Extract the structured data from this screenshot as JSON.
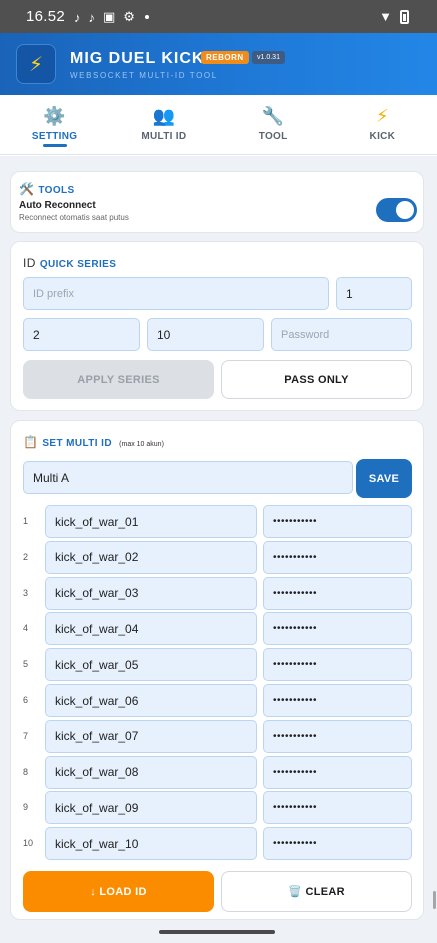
{
  "status": {
    "time": "16.52"
  },
  "app": {
    "logo_glyph": "⚡",
    "title": "MIG DUEL KICK",
    "badge": "REBORN",
    "version": "v1.0.31",
    "subtitle": "WEBSOCKET MULTI-ID TOOL",
    "accent": "#1f6fbf",
    "orange": "#fb8c00"
  },
  "tabs": [
    {
      "label": "SETTING",
      "icon": "gear-icon",
      "glyph": "⚙️"
    },
    {
      "label": "MULTI ID",
      "icon": "users-icon",
      "glyph": "👥"
    },
    {
      "label": "TOOL",
      "icon": "wrench-icon",
      "glyph": "🔧"
    },
    {
      "label": "KICK",
      "icon": "bolt-icon",
      "glyph": "⚡"
    }
  ],
  "tools": {
    "icon": "🛠️",
    "title": "TOOLS",
    "auto_reconnect_label": "Auto Reconnect",
    "auto_reconnect_desc": "Reconnect otomatis saat putus"
  },
  "quick_series": {
    "prefix_label": "ID",
    "title": "QUICK SERIES",
    "id_prefix_placeholder": "ID prefix",
    "start_value": "1",
    "field_a_value": "2",
    "field_b_value": "10",
    "password_placeholder": "Password",
    "apply_label": "APPLY SERIES",
    "pass_only_label": "PASS ONLY"
  },
  "multi_id": {
    "icon": "📋",
    "title": "SET MULTI ID",
    "hint": "(max 10 akun)",
    "name_value": "Multi A",
    "save_label": "SAVE",
    "rows": [
      {
        "num": "1",
        "id": "kick_of_war_01",
        "password": "•••••••••••"
      },
      {
        "num": "2",
        "id": "kick_of_war_02",
        "password": "•••••••••••"
      },
      {
        "num": "3",
        "id": "kick_of_war_03",
        "password": "•••••••••••"
      },
      {
        "num": "4",
        "id": "kick_of_war_04",
        "password": "•••••••••••"
      },
      {
        "num": "5",
        "id": "kick_of_war_05",
        "password": "•••••••••••"
      },
      {
        "num": "6",
        "id": "kick_of_war_06",
        "password": "•••••••••••"
      },
      {
        "num": "7",
        "id": "kick_of_war_07",
        "password": "•••••••••••"
      },
      {
        "num": "8",
        "id": "kick_of_war_08",
        "password": "•••••••••••"
      },
      {
        "num": "9",
        "id": "kick_of_war_09",
        "password": "•••••••••••"
      },
      {
        "num": "10",
        "id": "kick_of_war_10",
        "password": "•••••••••••"
      }
    ],
    "load_label": "↓ LOAD ID",
    "clear_label": "🗑️ CLEAR"
  }
}
